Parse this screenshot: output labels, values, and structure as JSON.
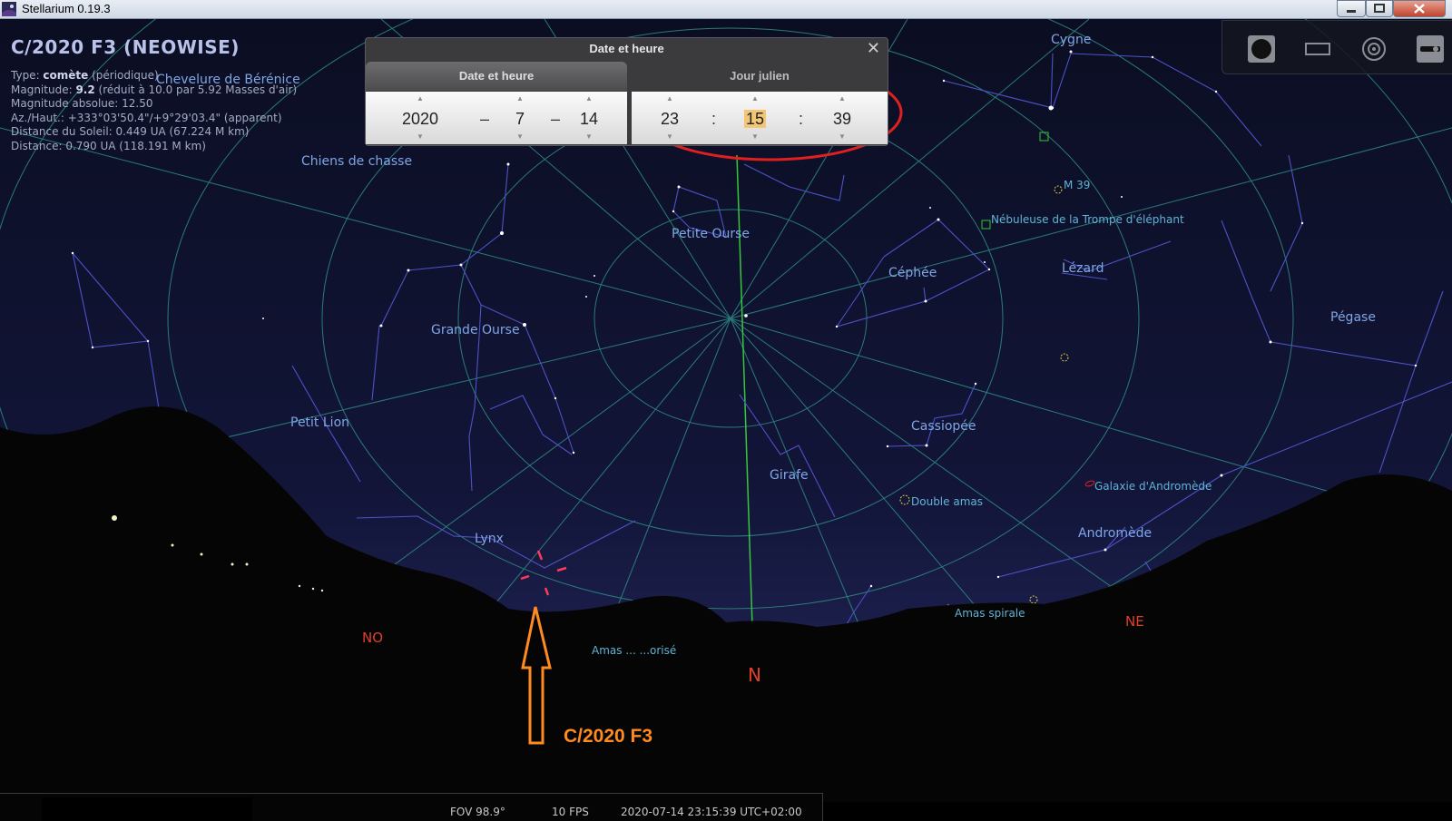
{
  "window": {
    "title": "Stellarium 0.19.3"
  },
  "selected_object": {
    "title": "C/2020 F3 (NEOWISE)",
    "info": [
      {
        "label": "Type: ",
        "value": "comète",
        "suffix": " (périodique)"
      },
      {
        "label": "Magnitude: ",
        "value": "9.2",
        "suffix": " (réduit à 10.0 par 5.92 Masses d'air)"
      },
      {
        "label": "Magnitude absolue: 12.50",
        "value": "",
        "suffix": ""
      },
      {
        "label": "Az./Haut.: +333°03'50.4\"/+9°29'03.4\" (apparent)",
        "value": "",
        "suffix": ""
      },
      {
        "label": "Distance du Soleil: 0.449 UA (67.224 M km)",
        "value": "",
        "suffix": ""
      },
      {
        "label": "Distance: 0.790 UA (118.191 M km)",
        "value": "",
        "suffix": ""
      }
    ]
  },
  "date_dialog": {
    "title": "Date et heure",
    "tab_date": "Date et heure",
    "tab_jd": "Jour julien",
    "year": "2020",
    "month": "7",
    "day": "14",
    "hour": "23",
    "minute": "15",
    "second": "39",
    "date_sep": "–",
    "time_sep": ":",
    "arrow_up": "▲",
    "arrow_down": "▼",
    "close": "✕"
  },
  "constellations": {
    "cygne": "Cygne",
    "chevelure": "Chevelure de Bérénice",
    "chiens": "Chiens de chasse",
    "petite_ourse": "Petite Ourse",
    "cephee": "Céphée",
    "lezard": "Lézard",
    "pegase": "Pégase",
    "grande_ourse": "Grande Ourse",
    "petit_lion": "Petit Lion",
    "cassiopee": "Cassiopée",
    "girafe": "Girafe",
    "lynx": "Lynx",
    "andromede": "Andromède"
  },
  "deep_sky": {
    "m39": "M 39",
    "trompe": "Nébuleuse de la Trompe d'éléphant",
    "double_amas": "Double amas",
    "galaxie": "Galaxie d'Andromède",
    "amas_spirale": "Amas spirale",
    "amas_bottom": "Amas ...   ...orisé"
  },
  "cardinals": {
    "no": "NO",
    "n": "N",
    "ne": "NE"
  },
  "annotation": {
    "label": "C/2020 F3"
  },
  "status": {
    "fov": "FOV 98.9°",
    "fps": "10 FPS",
    "datetime": "2020-07-14 23:15:39 UTC+02:00"
  },
  "colors": {
    "sky_top": "#0c0f24",
    "grid": "#2e8f86",
    "constellation_lines": "#4d52c8",
    "constellation_labels": "#7fa6e6",
    "dso_labels": "#5fb4d6",
    "cardinal": "#e0402a",
    "annotation_orange": "#ff8a1f",
    "highlight_circle": "#e02020",
    "meridian": "#36c83a"
  }
}
